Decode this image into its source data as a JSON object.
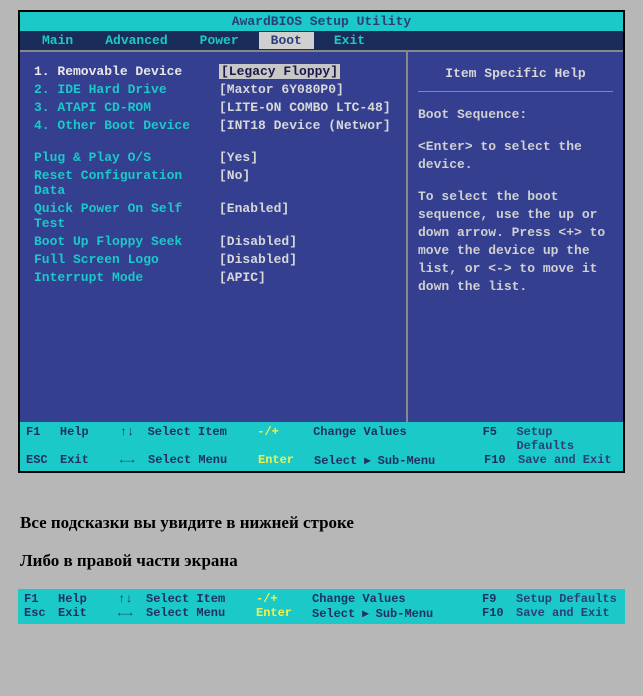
{
  "title": "AwardBIOS Setup Utility",
  "menu": [
    "Main",
    "Advanced",
    "Power",
    "Boot",
    "Exit"
  ],
  "activeMenu": "Boot",
  "bootItems": [
    {
      "label": "1. Removable Device",
      "value": "[Legacy Floppy]",
      "highlighted": true
    },
    {
      "label": "2. IDE Hard Drive",
      "value": "[Maxtor 6Y080P0]",
      "highlighted": false
    },
    {
      "label": "3. ATAPI CD-ROM",
      "value": "[LITE-ON COMBO LTC-48]",
      "highlighted": false
    },
    {
      "label": "4. Other Boot Device",
      "value": "[INT18 Device (Networ]",
      "highlighted": false
    }
  ],
  "settings": [
    {
      "label": "Plug & Play O/S",
      "value": "[Yes]"
    },
    {
      "label": "Reset Configuration Data",
      "value": "[No]"
    },
    {
      "label": "Quick Power On Self Test",
      "value": "[Enabled]"
    },
    {
      "label": "Boot Up Floppy Seek",
      "value": "[Disabled]"
    },
    {
      "label": "Full Screen Logo",
      "value": "[Disabled]"
    },
    {
      "label": "Interrupt Mode",
      "value": "[APIC]"
    }
  ],
  "help": {
    "title": "Item Specific Help",
    "p1": "Boot Sequence:",
    "p2": "<Enter> to select the device.",
    "p3": "To select the boot sequence, use the up or down arrow. Press <+> to move the device up the list, or <-> to move it down the list."
  },
  "footer": {
    "r1": {
      "k1": "F1",
      "l1": "Help",
      "a1": "↑↓",
      "ac1": "Select Item",
      "m1": "-/+",
      "mv1": "Change Values",
      "k2": "F5",
      "l2": "Setup Defaults"
    },
    "r2": {
      "k1": "ESC",
      "l1": "Exit",
      "a1": "←→",
      "ac1": "Select Menu",
      "m1": "Enter",
      "mv1": "Select ▸ Sub-Menu",
      "k2": "F10",
      "l2": "Save and Exit"
    }
  },
  "instructions": {
    "p1": "Все подсказки вы увидите в нижней строке",
    "p2": "Либо в правой части экрана"
  },
  "footer2": {
    "r1": {
      "k1": "F1",
      "l1": "Help",
      "a1": "↑↓",
      "ac1": "Select Item",
      "m1": "-/+",
      "mv1": "Change Values",
      "k2": "F9",
      "l2": "Setup Defaults"
    },
    "r2": {
      "k1": "Esc",
      "l1": "Exit",
      "a1": "←→",
      "ac1": "Select Menu",
      "m1": "Enter",
      "mv1": "Select ▸ Sub-Menu",
      "k2": "F10",
      "l2": "Save and Exit"
    }
  }
}
